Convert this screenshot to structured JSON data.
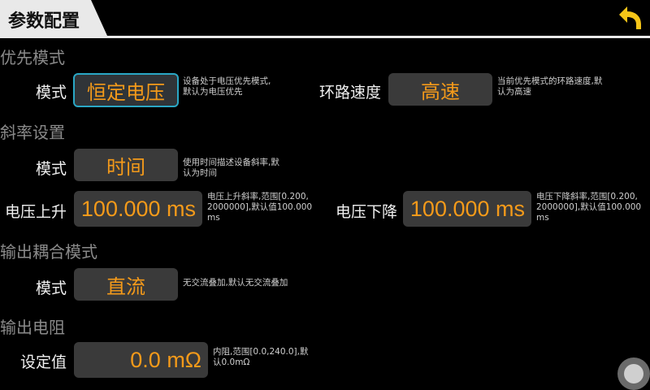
{
  "header": {
    "title": "参数配置",
    "back_icon": "back-arrow-icon",
    "accent": "#f5c518"
  },
  "priority": {
    "section": "优先模式",
    "mode_label": "模式",
    "mode_value": "恒定电压",
    "mode_hint": "设备处于电压优先模式,默认为电压优先",
    "loop_label": "环路速度",
    "loop_value": "高速",
    "loop_hint": "当前优先模式的环路速度,默认为高速"
  },
  "slope": {
    "section": "斜率设置",
    "mode_label": "模式",
    "mode_value": "时间",
    "mode_hint": "使用时间描述设备斜率,默认为时间",
    "rise_label": "电压上升",
    "rise_value": "100.000 ms",
    "rise_hint": "电压上升斜率,范围[0.200, 2000000],默认值100.000 ms",
    "fall_label": "电压下降",
    "fall_value": "100.000 ms",
    "fall_hint": "电压下降斜率,范围[0.200, 2000000],默认值100.000 ms"
  },
  "coupling": {
    "section": "输出耦合模式",
    "mode_label": "模式",
    "mode_value": "直流",
    "mode_hint": "无交流叠加,默认无交流叠加"
  },
  "resistance": {
    "section": "输出电阻",
    "set_label": "设定值",
    "set_value": "0.0 mΩ",
    "set_hint": "内阻,范围[0.0,240.0],默认0.0mΩ"
  },
  "colors": {
    "value_text": "#f49a1a",
    "selected_border": "#2aa7c5",
    "field_bg": "#3a3a3a"
  }
}
